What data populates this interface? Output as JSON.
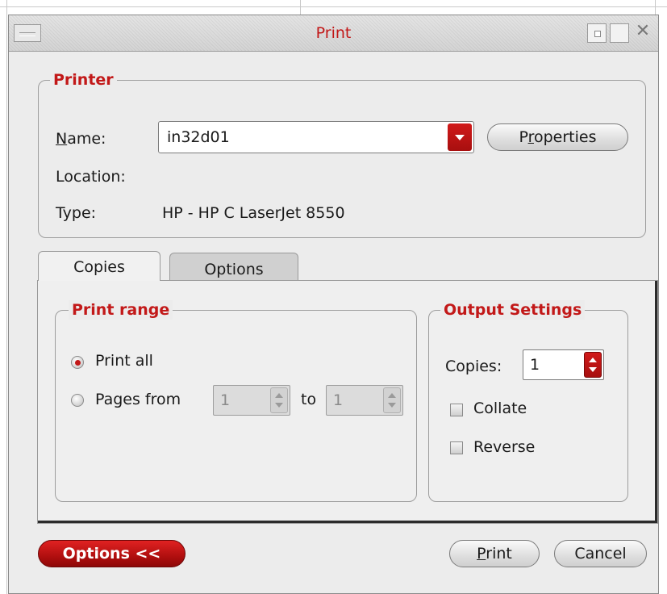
{
  "window": {
    "title": "Print"
  },
  "printer": {
    "legend": "Printer",
    "name_label_u": "N",
    "name_label_rest": "ame:",
    "name_value": "in32d01",
    "properties_u_pre": "P",
    "properties_u": "r",
    "properties_rest": "operties",
    "location_label": "Location:",
    "location_value": "",
    "type_label": "Type:",
    "type_value": "HP - HP C LaserJet 8550"
  },
  "tabs": [
    {
      "label": "Copies",
      "active": true
    },
    {
      "label": "Options",
      "active": false
    }
  ],
  "print_range": {
    "legend": "Print range",
    "print_all_label": "Print all",
    "pages_from_label": "Pages from",
    "from_value": "1",
    "to_label": "to",
    "to_value": "1"
  },
  "output_settings": {
    "legend": "Output Settings",
    "copies_label": "Copies:",
    "copies_value": "1",
    "collate_label": "Collate",
    "reverse_label": "Reverse"
  },
  "footer": {
    "options_label": "Options <<",
    "print_label_u": "P",
    "print_label_rest": "rint",
    "cancel_label": "Cancel"
  },
  "colors": {
    "accent": "#c21818",
    "window_bg": "#ececec"
  }
}
